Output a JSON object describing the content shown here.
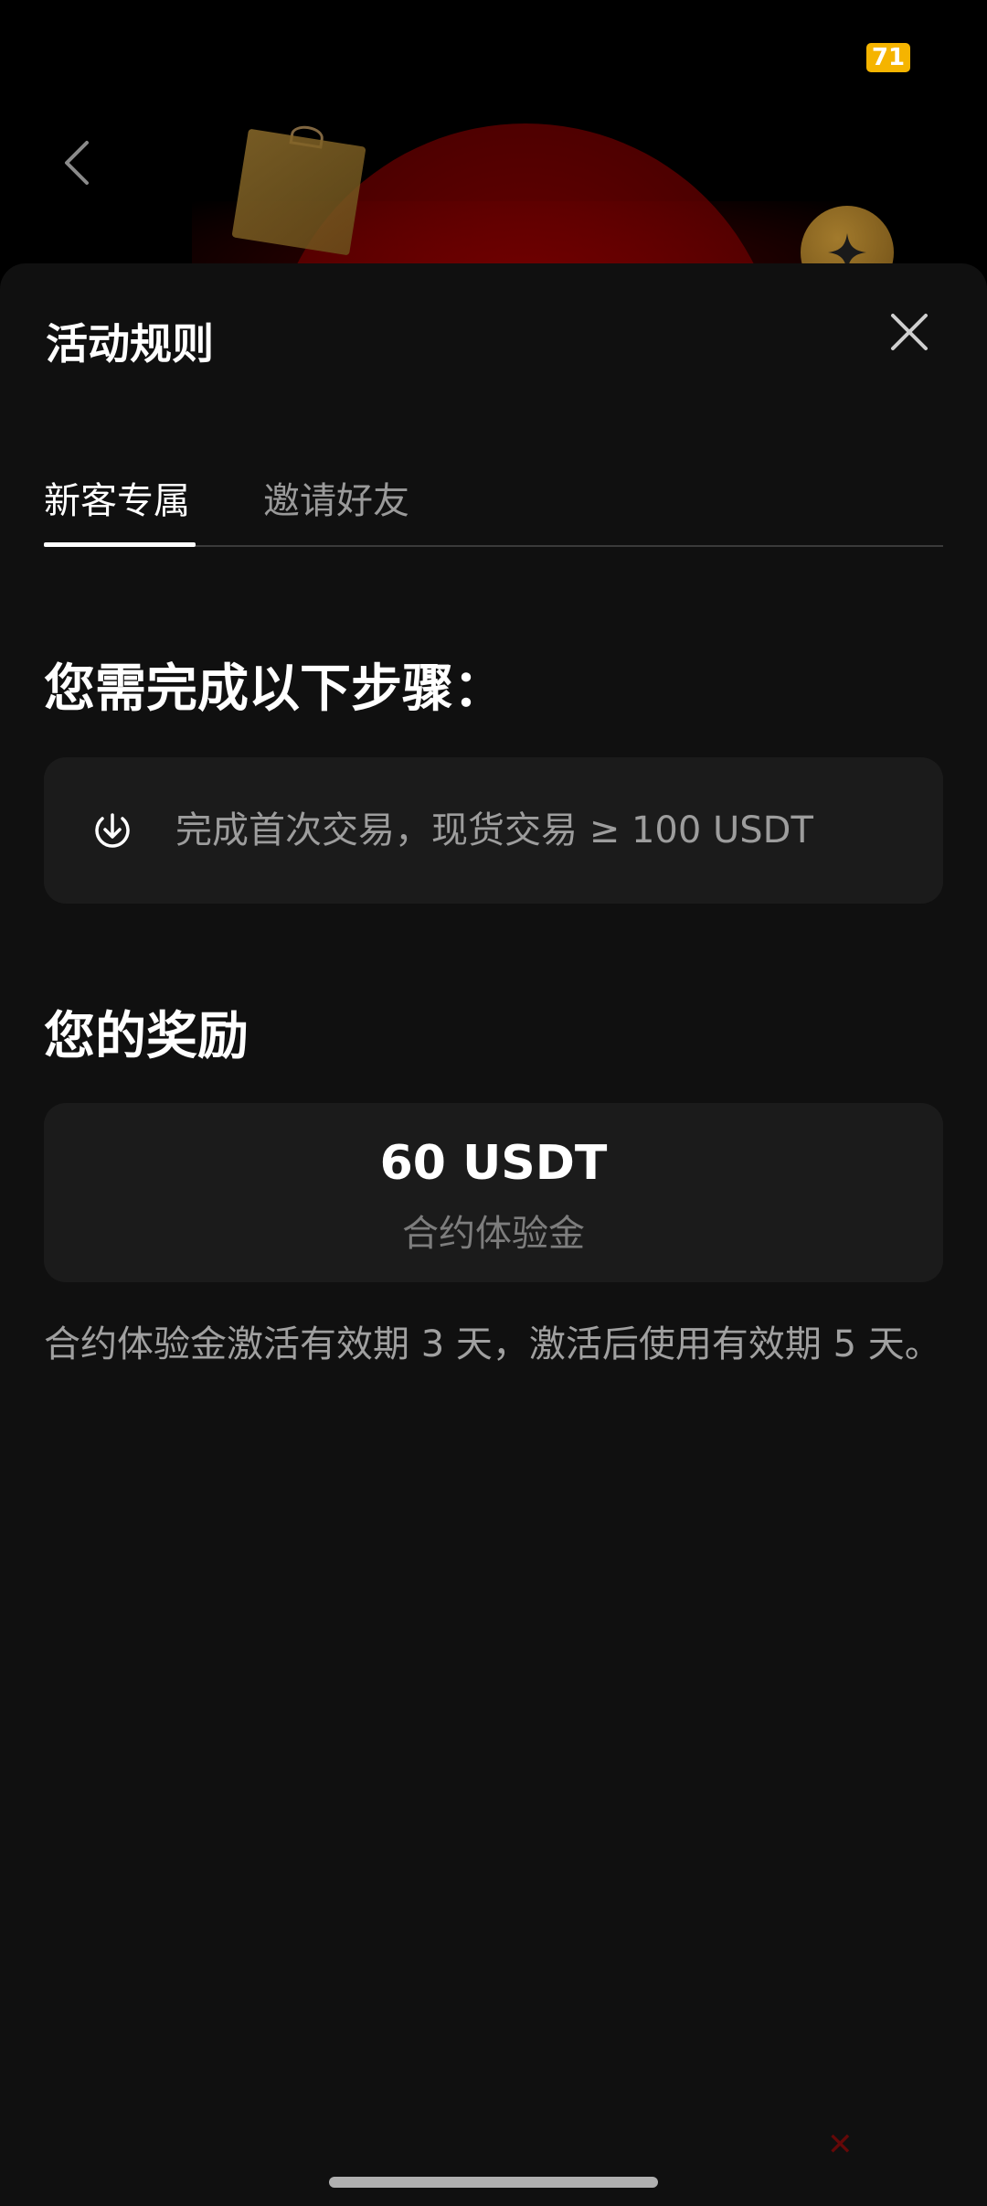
{
  "status_bar": {
    "battery": "71"
  },
  "sheet": {
    "title": "活动规则",
    "tabs": [
      {
        "label": "新客专属",
        "active": true
      },
      {
        "label": "邀请好友",
        "active": false
      }
    ],
    "steps_heading": "您需完成以下步骤：",
    "steps": [
      {
        "icon": "download-circle-icon",
        "text": "完成首次交易，现货交易 ≥ 100 USDT"
      }
    ],
    "reward_heading": "您的奖励",
    "reward": {
      "amount": "60 USDT",
      "label": "合约体验金"
    },
    "note": "合约体验金激活有效期 3 天，激活后使用有效期 5 天。"
  },
  "colors": {
    "sheet_bg": "#101010",
    "card_bg": "#1b1b1b",
    "badge": "#f5b400",
    "accent_red": "#6a0000"
  }
}
